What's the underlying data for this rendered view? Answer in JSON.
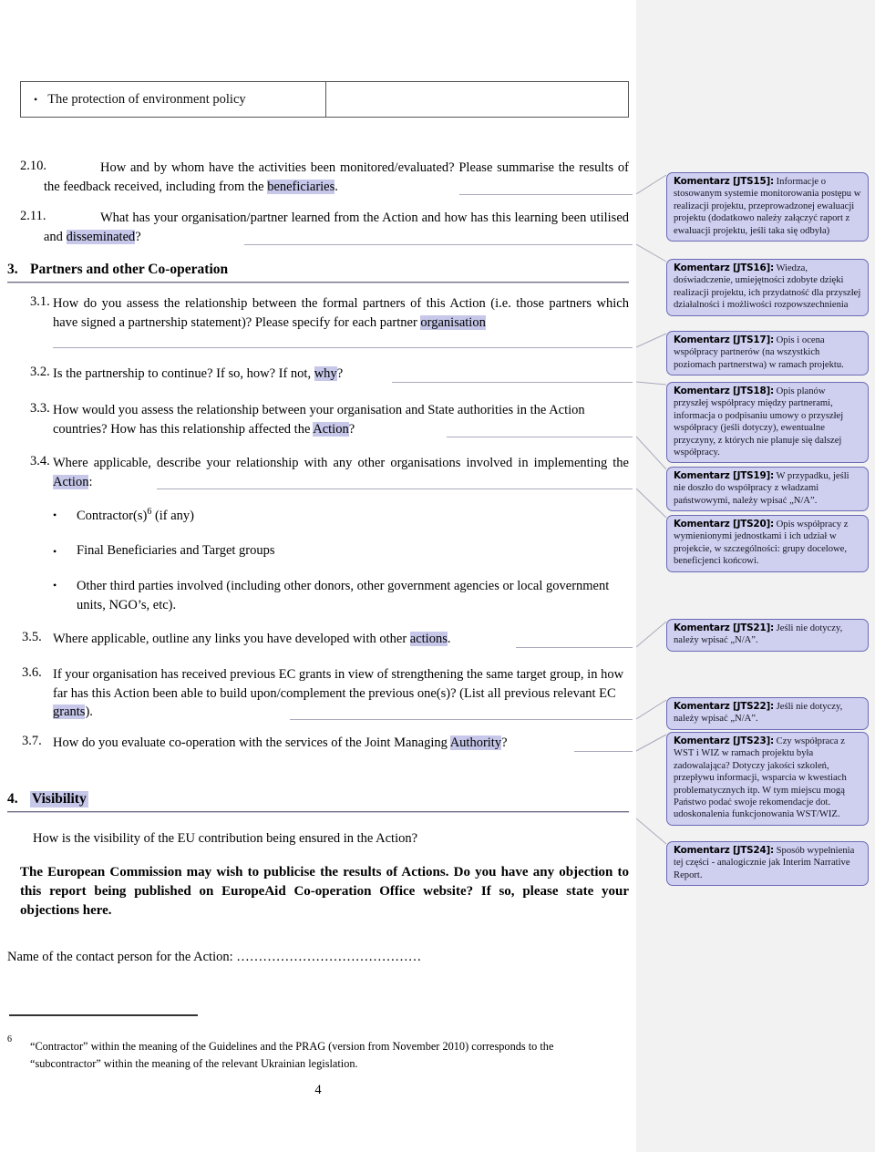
{
  "document": {
    "page_number": "4",
    "table": {
      "cell_bullet": "•",
      "cell_text": "The protection of environment policy",
      "cell_right": ""
    },
    "items": [
      {
        "number": "2.10.",
        "text_before": "How and by whom have the activities been monitored/evaluated? Please summarise the results of the feedback received, including from the ",
        "highlight": "beneficiaries",
        "text_after": "."
      },
      {
        "number": "2.11.",
        "text_before": "What has your organisation/partner learned from the Action and how has this learning been utilised and ",
        "highlight": "disseminated",
        "text_after": "?"
      },
      {
        "number": "3.1.",
        "text_before": "How do you assess the relationship between the formal partners of this Action (i.e. those partners which have signed a partnership statement)? Please specify for each partner ",
        "highlight": "organisation",
        "text_after": ""
      },
      {
        "number": "3.2.",
        "text_before": "Is the partnership to continue? If so, how? If not, ",
        "highlight": "why",
        "text_after": "?"
      },
      {
        "number": "3.3.",
        "text_before": "How would you assess the relationship between your organisation and State authorities in the Action countries? How has this relationship affected the ",
        "highlight": "Action",
        "text_after": "?"
      },
      {
        "number": "3.4.",
        "text_before": "Where applicable, describe your relationship with any other organisations involved in implementing the ",
        "highlight": "Action",
        "text_after": ":"
      },
      {
        "number": "3.5.",
        "text_before": "Where applicable, outline any links you have developed with other ",
        "highlight": "actions",
        "text_after": "."
      },
      {
        "number": "3.6.",
        "text_before": "If your organisation has received previous EC grants in view of strengthening the same target group, in how far has this Action been able to build upon/complement the previous one(s)? (List all previous relevant EC ",
        "highlight": "grants",
        "text_after": ")."
      },
      {
        "number": "3.7.",
        "text_before": "How do you evaluate co-operation with the services of the Joint Managing ",
        "highlight": "Authority",
        "text_after": "?"
      }
    ],
    "headings": {
      "section3_number": "3.",
      "section3_title": "Partners and other Co-operation",
      "section4_number": "4.",
      "section4_title": "Visibility"
    },
    "bullets": [
      {
        "marker": "•",
        "text": "Contractor(s)",
        "sup": "6",
        "text2": "(if any)"
      },
      {
        "marker": "•",
        "text": "Final Beneficiaries and Target groups",
        "sup": "",
        "text2": ""
      },
      {
        "marker": "•",
        "text": "Other third parties involved (including other donors, other government agencies or local government units, NGO’s, etc).",
        "sup": "",
        "text2": ""
      }
    ],
    "visibility": {
      "question": "How is the visibility of the EU contribution being ensured in the Action?",
      "statement": "The European Commission may wish to publicise the results of Actions. Do you have any objection to this report being published on EuropeAid Co-operation Office website?  If so, please state your objections here."
    },
    "contact_line": "Name of the contact person for the Action: ……………………………………",
    "footnote": {
      "mark": "6",
      "text": "“Contractor” within the meaning of the Guidelines and the PRAG (version from November 2010) corresponds to the “subcontractor” within the meaning of the relevant Ukrainian legislation."
    }
  },
  "comments": [
    {
      "label": "Komentarz [JTS15]:",
      "text": " Informacje o stosowanym systemie monitorowania postępu w realizacji projektu, przeprowadzonej ewaluacji projektu (dodatkowo należy załączyć raport z ewaluacji projektu, jeśli taka się odbyła)"
    },
    {
      "label": "Komentarz [JTS16]:",
      "text": " Wiedza, doświadczenie, umiejętności zdobyte dzięki realizacji projektu, ich przydatność dla przyszłej działalności i możliwości rozpowszechnienia"
    },
    {
      "label": "Komentarz [JTS17]:",
      "text": " Opis i ocena współpracy partnerów (na wszystkich poziomach partnerstwa) w ramach projektu."
    },
    {
      "label": "Komentarz [JTS18]:",
      "text": " Opis planów przyszłej współpracy między partnerami, informacja o podpisaniu umowy o przyszłej współpracy (jeśli dotyczy), ewentualne przyczyny, z których nie planuje się dalszej współpracy."
    },
    {
      "label": "Komentarz [JTS19]:",
      "text": " W przypadku, jeśli nie doszło do współpracy z władzami państwowymi, należy wpisać „N/A”."
    },
    {
      "label": "Komentarz [JTS20]:",
      "text": " Opis współpracy z wymienionymi jednostkami i ich udział w projekcie, w szczególności: grupy docelowe, beneficjenci końcowi."
    },
    {
      "label": "Komentarz [JTS21]:",
      "text": " Jeśli nie dotyczy, należy wpisać „N/A”."
    },
    {
      "label": "Komentarz [JTS22]:",
      "text": " Jeśli nie dotyczy, należy wpisać „N/A”."
    },
    {
      "label": "Komentarz [JTS23]:",
      "text": " Czy współpraca z WST i WIZ w ramach projektu była zadowalająca?  Dotyczy jakości szkoleń, przepływu informacji, wsparcia w kwestiach problematycznych itp. W tym miejscu mogą Państwo podać swoje rekomendacje dot. udoskonalenia funkcjonowania WST/WIZ."
    },
    {
      "label": "Komentarz [JTS24]:",
      "text": " Sposób wypełnienia tej części - analogicznie jak Interim Narrative Report."
    }
  ],
  "colors": {
    "highlight": "#c6c7e9",
    "comment_bg": "#cfd0f0",
    "comment_border": "#6b6bb5",
    "rail_bg": "#f2f2f2"
  }
}
